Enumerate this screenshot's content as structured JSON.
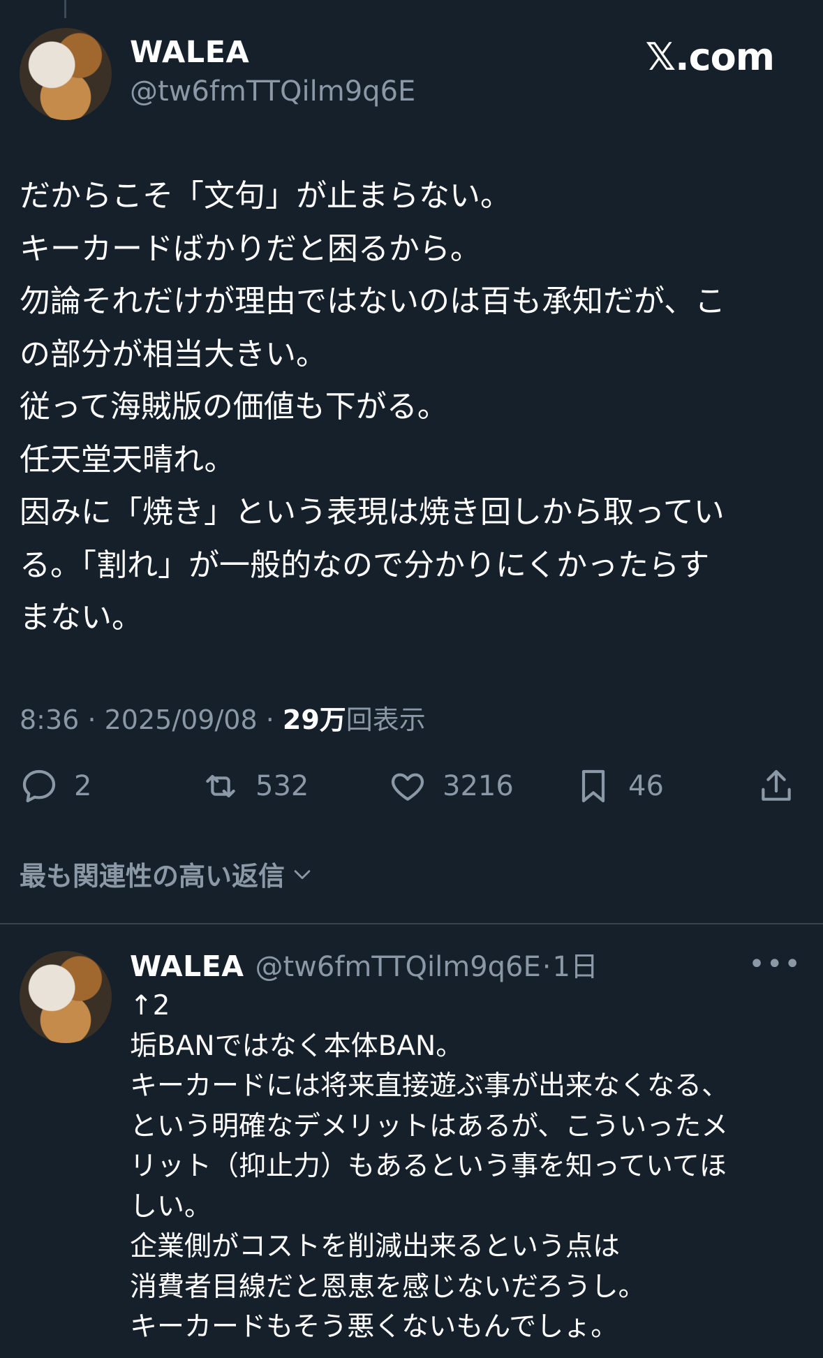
{
  "brand": {
    "logo_text": "𝕏.com"
  },
  "tweet": {
    "author_name": "WALEA",
    "author_handle": "@tw6fmTTQilm9q6E",
    "lines": [
      "だからこそ「文句」が止まらない。",
      "キーカードばかりだと困るから。",
      "勿論それだけが理由ではないのは百も承知だが、こ",
      "の部分が相当大きい。",
      "従って海賊版の価値も下がる。",
      "任天堂天晴れ。",
      "因みに「焼き」という表現は焼き回しから取ってい",
      "る。「割れ」が一般的なので分かりにくかったらす",
      "まない。"
    ],
    "time": "8:36",
    "date": "2025/09/08",
    "views_count": "29万",
    "views_label": "回表示",
    "replies": "2",
    "reposts": "532",
    "likes": "3216",
    "bookmarks": "46"
  },
  "sort_label": "最も関連性の高い返信",
  "reply": {
    "author_name": "WALEA",
    "author_handle": "@tw6fmTTQilm9q6E",
    "age": "1日",
    "lines": [
      "↑2",
      "垢BANではなく本体BAN。",
      "キーカードには将来直接遊ぶ事が出来なくなる、",
      "という明確なデメリットはあるが、こういったメ",
      "リット（抑止力）もあるという事を知っていてほ",
      "しい。",
      "企業側がコストを削減出来るという点は",
      "消費者目線だと恩恵を感じないだろうし。",
      "キーカードもそう悪くないもんでしょ。"
    ]
  },
  "colors": {
    "background": "#15202b",
    "text": "#ffffff",
    "muted": "#8b98a5",
    "divider": "#38444d"
  },
  "icons": [
    "reply-icon",
    "repost-icon",
    "like-icon",
    "bookmark-icon",
    "share-icon",
    "chevron-down-icon",
    "more-icon"
  ]
}
